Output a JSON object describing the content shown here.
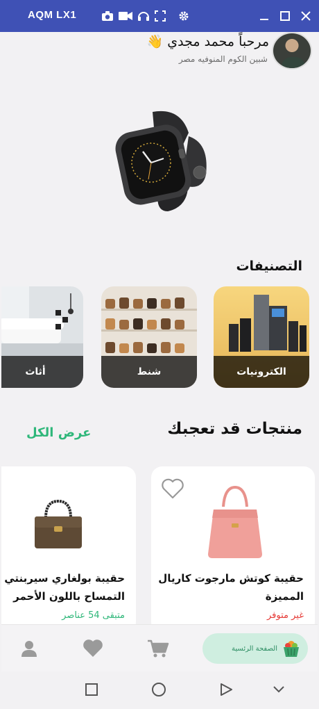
{
  "window": {
    "title": "AQM LX1",
    "accent_color": "#3f51b5",
    "toolbar_icons": [
      "camera-icon",
      "video-icon",
      "headphones-icon",
      "fullscreen-icon",
      "settings-icon"
    ],
    "controls": [
      "minimize-icon",
      "maximize-icon",
      "close-icon"
    ]
  },
  "header": {
    "greeting": "مرحباً محمد مجدي 👋",
    "location": "شبين الكوم المنوفيه مصر"
  },
  "categories": {
    "title": "التصنيفات",
    "items": [
      {
        "label": "الكترونيات"
      },
      {
        "label": "شنط"
      },
      {
        "label": "أثاث"
      }
    ]
  },
  "products": {
    "title": "منتجات قد تعجبك",
    "view_all": "عرض الكل",
    "items": [
      {
        "name": "حقيبة كوتش مارجوت كاريال المميزة",
        "status": "غير متوفر",
        "status_color": "#e53935"
      },
      {
        "name": "حقيبة بولغاري سيربنتي جلد التمساح باللون الأحمر",
        "status": "متبقى 54 عناصر",
        "status_color": "#2fb77a"
      }
    ]
  },
  "bottom_nav": {
    "home_label": "الصفحة الرئسية",
    "accent_color": "#2fb77a"
  }
}
